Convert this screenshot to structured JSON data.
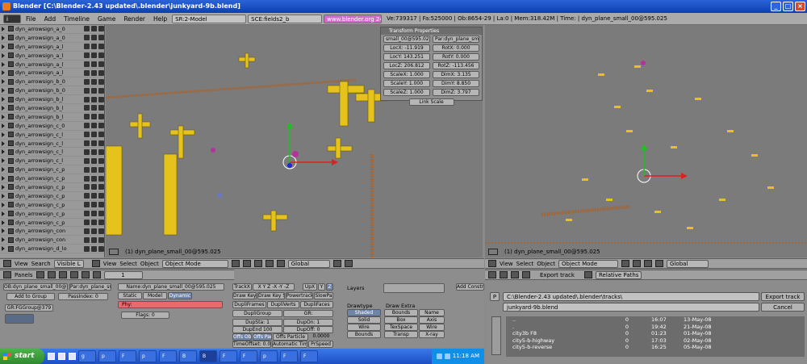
{
  "window": {
    "title": "Blender [C:\\Blender-2.43 updated\\.blender\\junkyard-9b.blend]"
  },
  "menu": {
    "items": [
      "File",
      "Add",
      "Timeline",
      "Game",
      "Render",
      "Help"
    ],
    "screen": "SR:2-Model",
    "scene": "SCE:fields2_b",
    "url": "www.blender.org 243",
    "stats": "Ve:739317 | Fa:525000 | Ob:8654-29 | La:0 | Mem:318.42M | Time: | dyn_plane_small_00@595.025"
  },
  "outliner": {
    "rows": [
      "dyn_arrowsign_a_0",
      "dyn_arrowsign_a_0",
      "dyn_arrowsign_a_l",
      "dyn_arrowsign_a_l",
      "dyn_arrowsign_a_l",
      "dyn_arrowsign_a_l",
      "dyn_arrowsign_b_0",
      "dyn_arrowsign_b_0",
      "dyn_arrowsign_b_l",
      "dyn_arrowsign_b_l",
      "dyn_arrowsign_b_l",
      "dyn_arrowsign_c_0",
      "dyn_arrowsign_c_l",
      "dyn_arrowsign_c_l",
      "dyn_arrowsign_c_l",
      "dyn_arrowsign_c_l",
      "dyn_arrowsign_c_p",
      "dyn_arrowsign_c_p",
      "dyn_arrowsign_c_p",
      "dyn_arrowsign_c_p",
      "dyn_arrowsign_c_p",
      "dyn_arrowsign_c_p",
      "dyn_arrowsign_c_p",
      "dyn_arrowsign_con",
      "dyn_arrowsign_con",
      "dyn_arrowsign_d_lo"
    ]
  },
  "viewport_left": {
    "label": "(1) dyn_plane_small_00@595.025"
  },
  "viewport_right": {
    "label": "(1) dyn_plane_small_00@595.025"
  },
  "transform": {
    "title": "Transform Properties",
    "ob": "small_00@595.025",
    "par": "Par:dyn_plane_small",
    "locx": "LocX: -11.919",
    "locy": "LocY: 143.251",
    "locz": "LocZ: 206.812",
    "rotx": "RotX: 0.000",
    "roty": "RotY: 0.000",
    "rotz": "RotZ: -113.456",
    "scalex": "ScaleX: 1.000",
    "scaley": "ScaleY: 1.000",
    "scalez": "ScaleZ: 1.000",
    "dimx": "DimX: 3.135",
    "dimy": "DimY: 8.850",
    "dimz": "DimZ: 3.797",
    "link_scale": "Link Scale"
  },
  "header_left": {
    "search": "Search",
    "visible": "Visible L",
    "view": "View",
    "select": "Select",
    "object": "Object",
    "mode": "Object Mode",
    "global": "Global"
  },
  "header_right": {
    "view": "View",
    "select": "Select",
    "object": "Object",
    "mode": "Object Mode",
    "global": "Global"
  },
  "buttons": {
    "panels": "Panels",
    "frame": "1",
    "ob_name": "Name:dyn_plane_small_00@595.025",
    "ob_field": "OB:dyn_plane_small_00@595.025",
    "par": "Par:dyn_plane_small",
    "static": "Static",
    "model": "Model",
    "dynamic": "Dynamic",
    "phy": "Phy:",
    "add_group": "Add to Group",
    "passindex": "PassIndex: 0",
    "grp": "GR:FGGroup@379",
    "flags": "Flags: 0",
    "trackx": "TrackX",
    "axes": "X  Y  Z  -X  -Y  -Z",
    "upx": "UpX",
    "upy": "Y",
    "upz": "Z",
    "draw_key": "Draw Key",
    "draw_key_s": "Draw Key S",
    "powertrack": "Powertrack",
    "slowpa": "SlowPa",
    "dupli_frames": "DupliFrames",
    "dupli_verts": "DupliVerts",
    "dupli_faces": "DupliFaces",
    "dupli_group": "DupliGroup",
    "gr": "GR:",
    "dupsta": "DupSta: 1",
    "dupon": "DupOn: 1",
    "dupend": "DupEnd 100",
    "dupoff": "DupOff: 0",
    "offs_ob": "Offs Ob",
    "offs_par": "Offs Par",
    "offs_particle": "Offs Particle",
    "time_value": "0.0000",
    "timeoffset": "TimeOffset: 0.00",
    "automatic_time": "Automatic Time",
    "prspeed": "PrSpeed",
    "layers": "Layers",
    "drawtype": "Drawtype",
    "draw_extra": "Draw Extra",
    "shaded": "Shaded",
    "solid": "Solid",
    "wire": "Wire",
    "bounds": "Bounds",
    "bounds2": "Bounds",
    "box": "Box",
    "texspace": "TexSpace",
    "transp": "Transp",
    "name": "Name",
    "axis": "Axis",
    "wire2": "Wire",
    "xray": "X-ray",
    "add_constraint": "Add Constr"
  },
  "filebrowser": {
    "header_label": "Export track",
    "relative_paths": "Relative Paths",
    "path": "C:\\Blender-2.43 updated\\.blender\\tracks\\",
    "filename": "junkyard-9b.blend",
    "export_btn": "Export track",
    "cancel_btn": "Cancel",
    "p_btn": "P",
    "files": [
      {
        "name": "..",
        "size": "0",
        "time": "16:07",
        "date": "13-May-08"
      },
      {
        "name": ".",
        "size": "0",
        "time": "19:42",
        "date": "21-May-08"
      },
      {
        "name": "city3b F8",
        "size": "0",
        "time": "01:23",
        "date": "01-May-08"
      },
      {
        "name": "city5-b-highway",
        "size": "0",
        "time": "17:03",
        "date": "02-May-08"
      },
      {
        "name": "city5-b-reverse",
        "size": "0",
        "time": "16:25",
        "date": "05-May-08"
      }
    ]
  },
  "taskbar": {
    "start": "start",
    "tasks": [
      "g",
      "p",
      "F",
      "p",
      "F",
      "B",
      "B",
      "F",
      "F",
      "p",
      "F",
      "F"
    ],
    "clock": "11:18 AM"
  },
  "colors": {
    "accent": "#d06cc8",
    "titlebar": "#0a3fb0",
    "taskbar": "#245edb"
  }
}
